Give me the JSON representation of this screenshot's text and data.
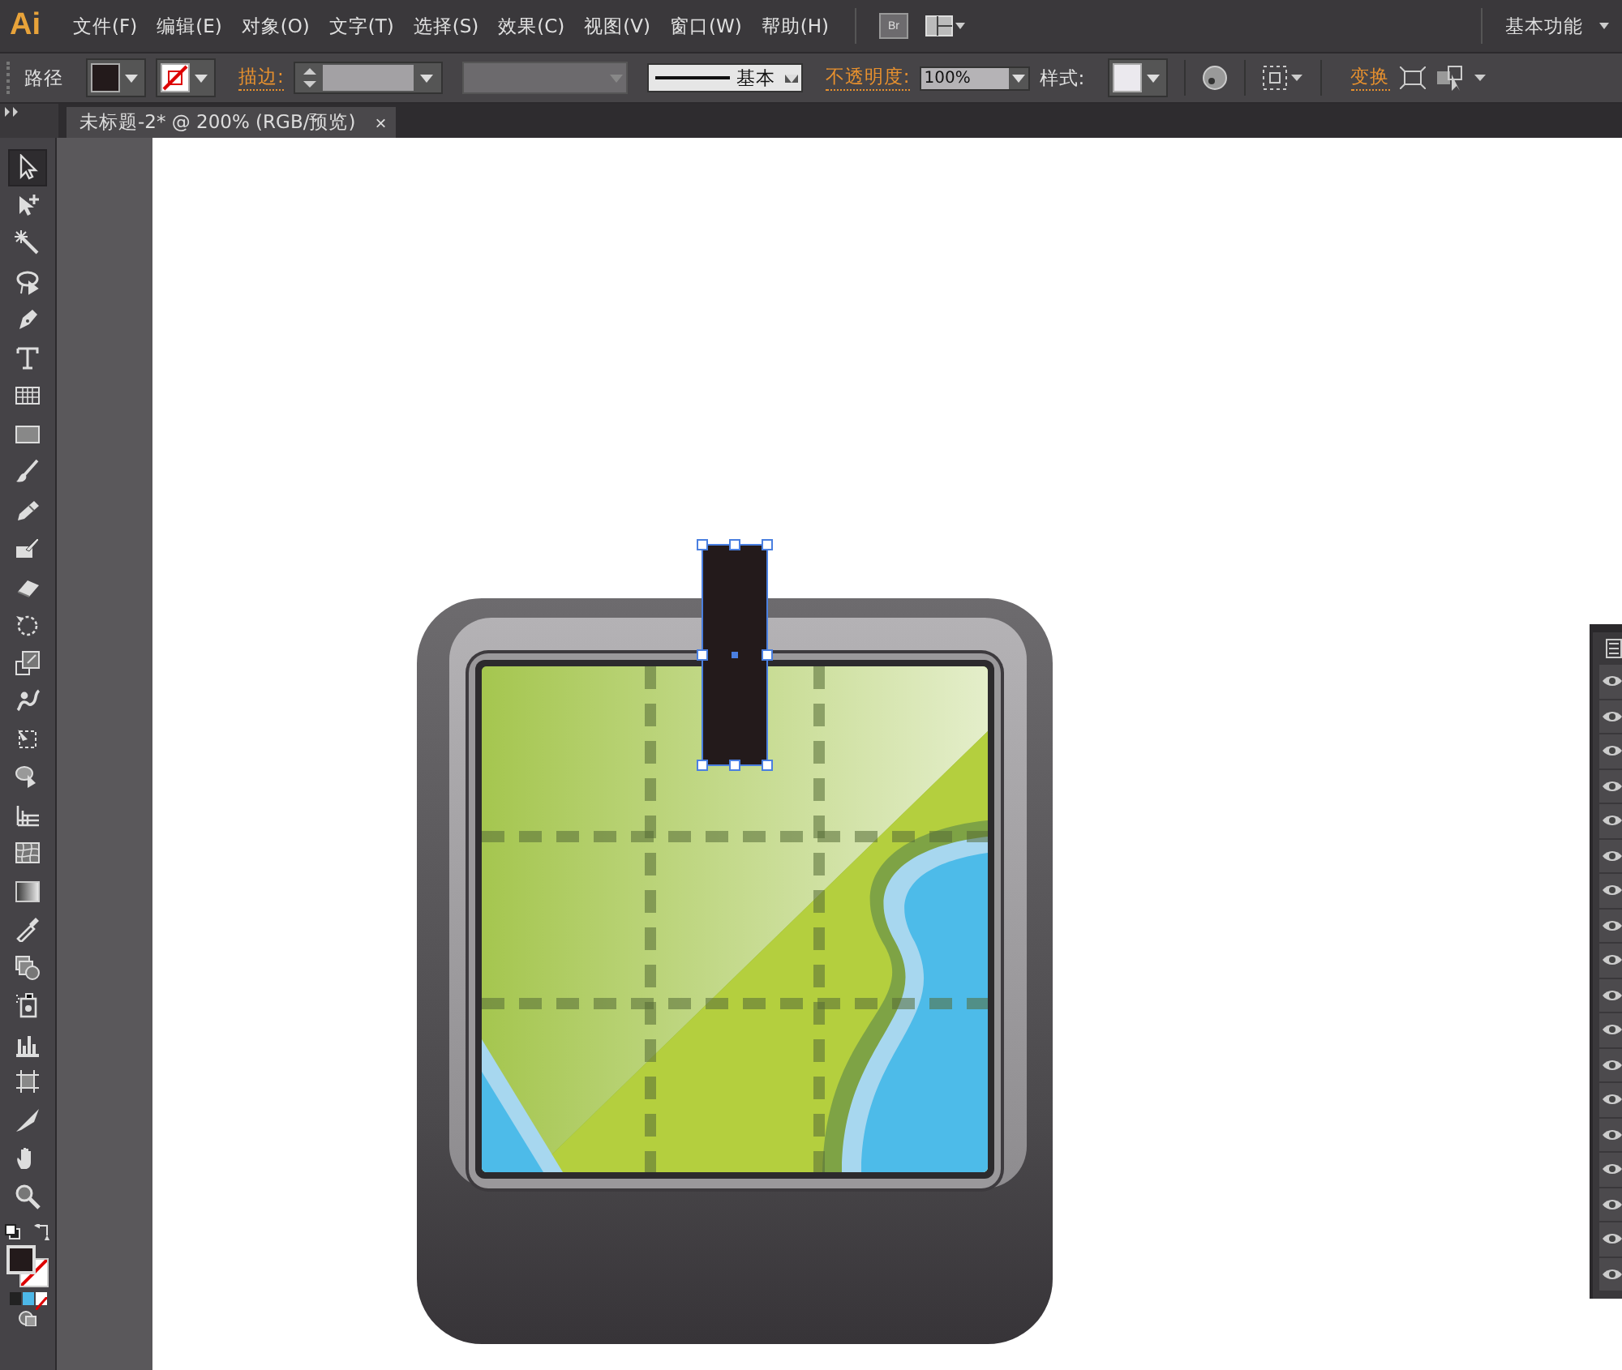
{
  "app": {
    "logo": "Ai"
  },
  "menu": [
    "文件(F)",
    "编辑(E)",
    "对象(O)",
    "文字(T)",
    "选择(S)",
    "效果(C)",
    "视图(V)",
    "窗口(W)",
    "帮助(H)"
  ],
  "bridge_button": "Br",
  "workspace": "基本功能",
  "control_bar": {
    "object_type": "路径",
    "stroke_label": "描边:",
    "stroke_profile": "基本",
    "opacity_label": "不透明度:",
    "opacity": "100%",
    "style_label": "样式:",
    "transform_label": "变换"
  },
  "document_tab": {
    "title": "未标题-2* @ 200% (RGB/预览)",
    "close": "×"
  },
  "tools": [
    {
      "kind": "selection",
      "selected": true
    },
    {
      "kind": "direct-selection",
      "selected": false
    },
    {
      "kind": "magic-wand",
      "selected": false
    },
    {
      "kind": "lasso",
      "selected": false
    },
    {
      "kind": "pen",
      "selected": false
    },
    {
      "kind": "type",
      "selected": false
    },
    {
      "kind": "grid",
      "selected": false
    },
    {
      "kind": "rectangle",
      "selected": false
    },
    {
      "kind": "brush",
      "selected": false
    },
    {
      "kind": "pencil",
      "selected": false
    },
    {
      "kind": "blob-brush",
      "selected": false
    },
    {
      "kind": "eraser",
      "selected": false
    },
    {
      "kind": "rotate",
      "selected": false
    },
    {
      "kind": "scale",
      "selected": false
    },
    {
      "kind": "warp",
      "selected": false
    },
    {
      "kind": "free-transform",
      "selected": false
    },
    {
      "kind": "shape-builder",
      "selected": false
    },
    {
      "kind": "perspective",
      "selected": false
    },
    {
      "kind": "mesh",
      "selected": false
    },
    {
      "kind": "gradient",
      "selected": false
    },
    {
      "kind": "eyedropper",
      "selected": false
    },
    {
      "kind": "blend",
      "selected": false
    },
    {
      "kind": "sprayer",
      "selected": false
    },
    {
      "kind": "graph",
      "selected": false
    },
    {
      "kind": "artboard",
      "selected": false
    },
    {
      "kind": "slice",
      "selected": false
    },
    {
      "kind": "hand",
      "selected": false
    },
    {
      "kind": "zoom",
      "selected": false
    }
  ],
  "layers_panel": {
    "rows": [
      {
        "visible": true
      },
      {
        "visible": true
      },
      {
        "visible": true
      },
      {
        "visible": true
      },
      {
        "visible": true
      },
      {
        "visible": true
      },
      {
        "visible": true
      },
      {
        "visible": true
      },
      {
        "visible": true
      },
      {
        "visible": true
      },
      {
        "visible": true
      },
      {
        "visible": true
      },
      {
        "visible": true
      },
      {
        "visible": true
      },
      {
        "visible": true
      },
      {
        "visible": true
      },
      {
        "visible": true
      },
      {
        "visible": true
      }
    ]
  }
}
